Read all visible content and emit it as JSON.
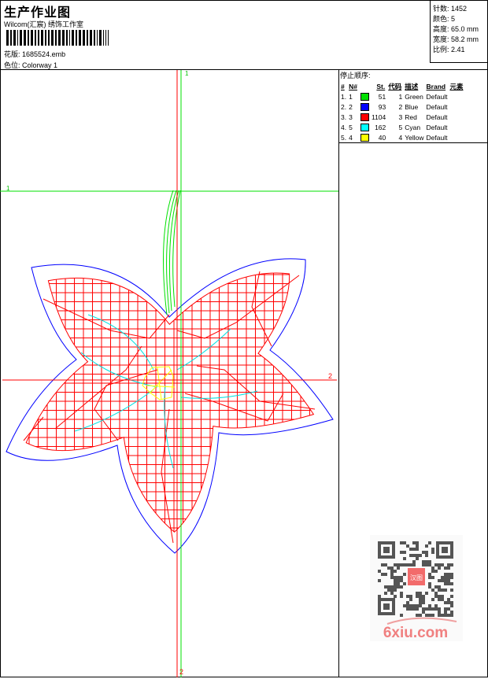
{
  "header": {
    "title": "生产作业图",
    "company": "Wilcom(汇宸) 绣饰工作室",
    "design_label": "花版:",
    "design_value": "1685524.emb",
    "colorway_label": "色位:",
    "colorway_value": "Colorway 1"
  },
  "info": [
    {
      "label": "针数:",
      "value": "1452"
    },
    {
      "label": "颜色:",
      "value": "5"
    },
    {
      "label": "高度:",
      "value": "65.0 mm"
    },
    {
      "label": "宽度:",
      "value": "58.2 mm"
    },
    {
      "label": "比例:",
      "value": "2.41"
    }
  ],
  "legend": {
    "title": "停止顺序:",
    "headers": [
      "#",
      "N#",
      "",
      "St.",
      "代码",
      "描述",
      "Brand",
      "元素"
    ],
    "rows": [
      {
        "idx": "1.",
        "n": "1",
        "color": "#00e000",
        "st": "51",
        "code": "1",
        "desc": "Green",
        "brand": "Default"
      },
      {
        "idx": "2.",
        "n": "2",
        "color": "#0000ff",
        "st": "93",
        "code": "2",
        "desc": "Blue",
        "brand": "Default"
      },
      {
        "idx": "3.",
        "n": "3",
        "color": "#ff0000",
        "st": "1104",
        "code": "3",
        "desc": "Red",
        "brand": "Default"
      },
      {
        "idx": "4.",
        "n": "5",
        "color": "#00ffff",
        "st": "162",
        "code": "5",
        "desc": "Cyan",
        "brand": "Default"
      },
      {
        "idx": "5.",
        "n": "4",
        "color": "#ffff00",
        "st": "40",
        "code": "4",
        "desc": "Yellow",
        "brand": "Default"
      }
    ]
  },
  "axes": {
    "v1": "1",
    "h1": "1",
    "h2": "2",
    "v2": "2"
  },
  "watermark": {
    "text": "6xiu.com",
    "seal": "汉图"
  }
}
